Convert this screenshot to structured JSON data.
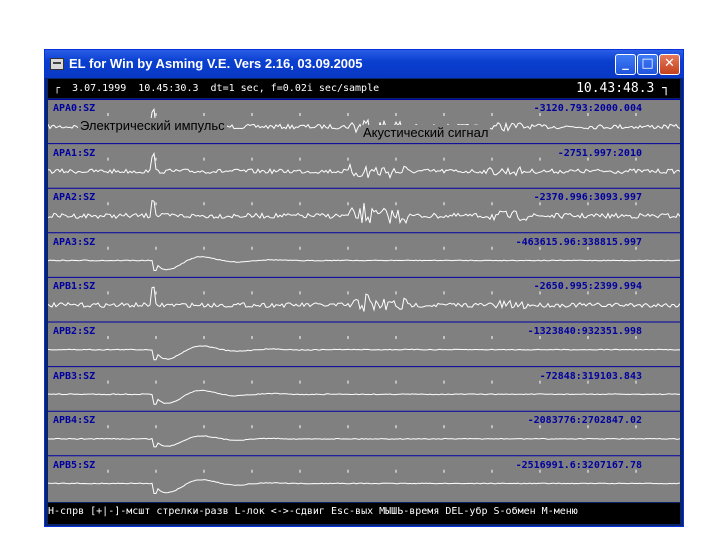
{
  "window": {
    "title": "EL for Win by Asming V.E. Vers 2.16, 03.09.2005",
    "minimize": "_",
    "maximize": "□",
    "close": "✕"
  },
  "header": {
    "info": "┌  3.07.1999  10.45:30.3  dt=1 sec, f=0.02i sec/sample",
    "clock": "10.43:48.3 ┐"
  },
  "annotations": {
    "electric": "Электрический импульс",
    "acoustic": "Акустический сигнал"
  },
  "channels": [
    {
      "label": "APA0:SZ",
      "range": "-3120.793:2000.004",
      "kind": "noise",
      "amp": 0.9
    },
    {
      "label": "APA1:SZ",
      "range": "-2751.997:2010",
      "kind": "noise",
      "amp": 0.9
    },
    {
      "label": "APA2:SZ",
      "range": "-2370.996:3093.997",
      "kind": "noise",
      "amp": 1.0
    },
    {
      "label": "APA3:SZ",
      "range": "-463615.96:338815.997",
      "kind": "pulse",
      "amp": 1.0
    },
    {
      "label": "APB1:SZ",
      "range": "-2650.995:2399.994",
      "kind": "noise",
      "amp": 0.9
    },
    {
      "label": "APB2:SZ",
      "range": "-1323840:932351.998",
      "kind": "pulse",
      "amp": 1.0
    },
    {
      "label": "APB3:SZ",
      "range": "-72848:319103.843",
      "kind": "pulse",
      "amp": 1.0
    },
    {
      "label": "APB4:SZ",
      "range": "-2083776:2702847.02",
      "kind": "pulse",
      "amp": 0.8
    },
    {
      "label": "APB5:SZ",
      "range": "-2516991.6:3207167.78",
      "kind": "pulse",
      "amp": 1.0
    }
  ],
  "status": "H-спрв [+|-]-мсшт стрелки-разв L-лок <->-сдвиг Esc-вых МЫШЬ-время DEL-убр S-обмен M-меню",
  "colors": {
    "plot_bg": "#808080",
    "trace": "#ffffff",
    "separator": "#0000a0",
    "label": "#0000a0"
  }
}
